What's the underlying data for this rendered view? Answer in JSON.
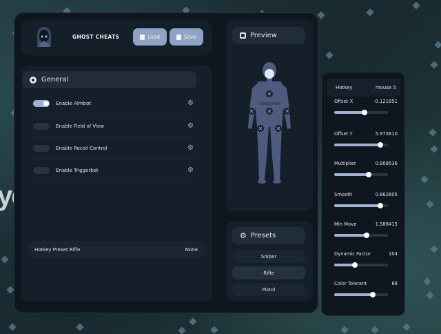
{
  "background": {
    "text": "yc"
  },
  "header": {
    "brand": "GHOST CHEATS",
    "load_label": "Load",
    "save_label": "Save"
  },
  "general": {
    "title": "General",
    "items": [
      {
        "label": "Enable Aimbot",
        "enabled": true
      },
      {
        "label": "Enable Field of View",
        "enabled": false
      },
      {
        "label": "Enable Recoil Control",
        "enabled": false
      },
      {
        "label": "Enable Triggerbot",
        "enabled": false
      }
    ],
    "hotkey_preset": {
      "label": "Hotkey Preset Rifle",
      "value": "None"
    }
  },
  "preview": {
    "title": "Preview"
  },
  "presets": {
    "title": "Presets",
    "items": [
      {
        "label": "Sniper",
        "active": false
      },
      {
        "label": "Rifle",
        "active": true
      },
      {
        "label": "Pistol",
        "active": false
      }
    ]
  },
  "settings": {
    "hotkey": {
      "label": "Hotkey",
      "value": "mouse 5"
    },
    "sliders": [
      {
        "label": "Offset X",
        "value": "-0.121951",
        "fraction": 0.57
      },
      {
        "label": "Offset Y",
        "value": "5.975610",
        "fraction": 0.86
      },
      {
        "label": "Multiplier",
        "value": "0.908536",
        "fraction": 0.64
      },
      {
        "label": "Smooth",
        "value": "0.862805",
        "fraction": 0.86
      },
      {
        "label": "Min Move",
        "value": "1.588415",
        "fraction": 0.6
      },
      {
        "label": "Dynamic Factor",
        "value": "104",
        "fraction": 0.38
      },
      {
        "label": "Color Tolerant",
        "value": "68",
        "fraction": 0.72
      }
    ]
  },
  "colors": {
    "accent": "#9fb1d0",
    "button": "#8fa3c4",
    "panel": "#0e1720"
  }
}
